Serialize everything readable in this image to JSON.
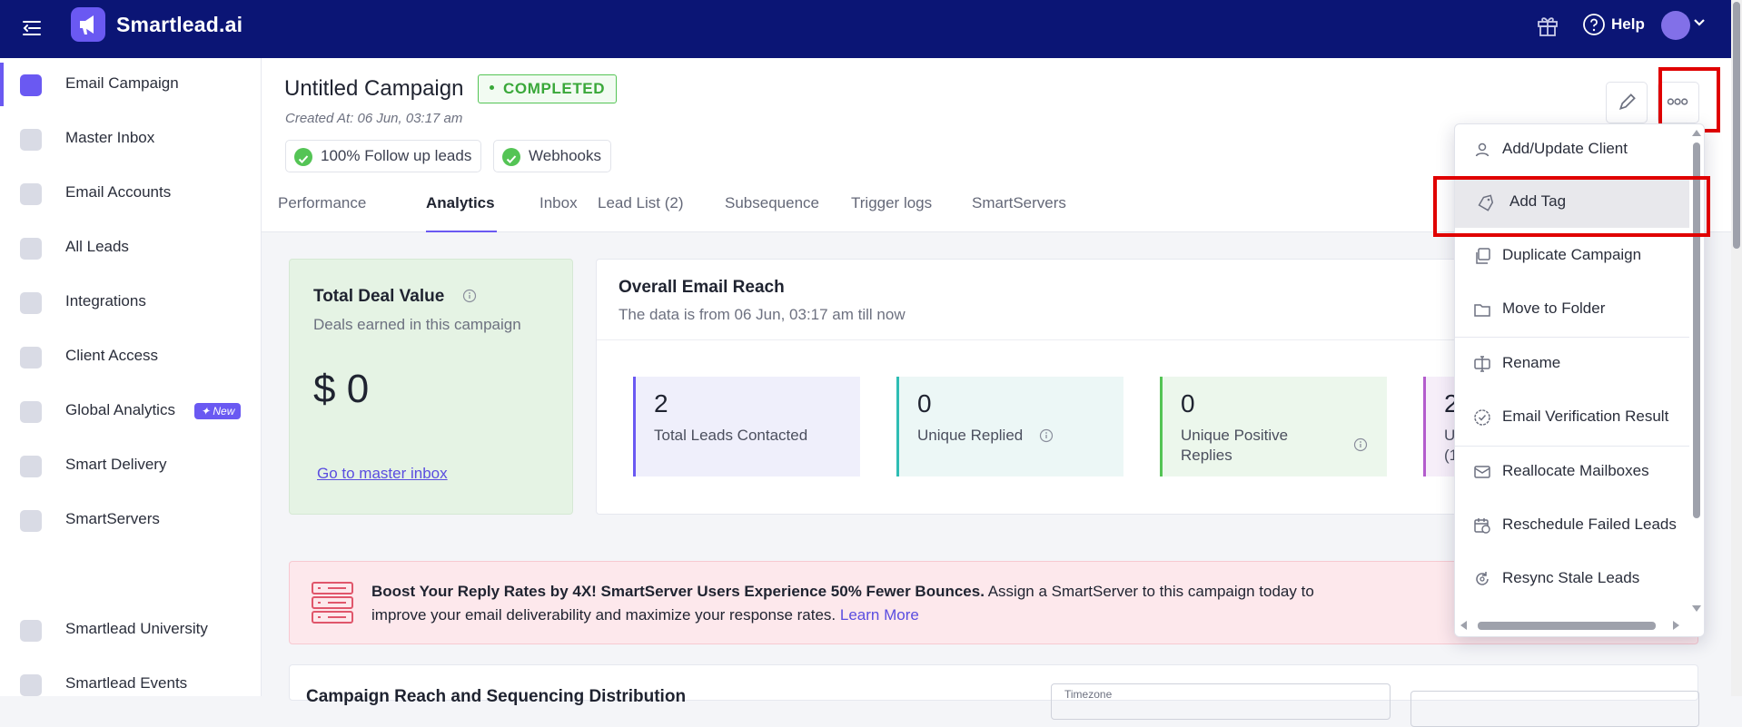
{
  "app": {
    "name": "Smartlead.ai",
    "help_label": "Help"
  },
  "icons": {
    "hamburger": "menu-collapse-icon",
    "logo": "megaphone-logo-icon",
    "gift": "gift-icon",
    "help": "question-circle-icon",
    "avatar": "user-avatar",
    "chevron": "chevron-down-icon"
  },
  "colors": {
    "topbar": "#0b1575",
    "accent": "#6a59f2",
    "success": "#54c455",
    "highlight": "#e00000"
  },
  "sidebar": {
    "items": [
      {
        "label": "Email Campaign",
        "icon": "megaphone-icon",
        "active": true
      },
      {
        "label": "Master Inbox",
        "icon": "inbox-icon"
      },
      {
        "label": "Email Accounts",
        "icon": "mail-icon"
      },
      {
        "label": "All Leads",
        "icon": "leads-icon"
      },
      {
        "label": "Integrations",
        "icon": "puzzle-icon"
      },
      {
        "label": "Client Access",
        "icon": "lightning-icon"
      },
      {
        "label": "Global Analytics",
        "icon": "bar-chart-icon",
        "badge": "✦ New"
      },
      {
        "label": "Smart Delivery",
        "icon": "layers-icon"
      },
      {
        "label": "SmartServers",
        "icon": "server-icon"
      }
    ],
    "bottom_items": [
      {
        "label": "Smartlead University",
        "icon": "university-icon"
      },
      {
        "label": "Smartlead Events",
        "icon": "events-icon"
      }
    ]
  },
  "campaign": {
    "title": "Untitled Campaign",
    "status": "COMPLETED",
    "created_at": "Created At: 06 Jun, 03:17 am",
    "pills": [
      "100% Follow up leads",
      "Webhooks"
    ]
  },
  "tabs": [
    "Performance",
    "Analytics",
    "Inbox",
    "Lead List (2)",
    "Subsequence",
    "Trigger logs",
    "SmartServers"
  ],
  "active_tab": "Analytics",
  "deal": {
    "title": "Total Deal Value",
    "subtitle": "Deals earned in this campaign",
    "value": "$ 0",
    "link": "Go to master inbox"
  },
  "reach": {
    "title": "Overall Email Reach",
    "subtitle": "The data is from 06 Jun, 03:17 am till now",
    "stats": [
      {
        "value": "2",
        "label": "Total Leads Contacted",
        "color": "#6a59f2",
        "bg": "#efeffb"
      },
      {
        "value": "0",
        "label": "Unique Replied",
        "color": "#2ebdb4",
        "bg": "#ecf7f6",
        "info": true
      },
      {
        "value": "0",
        "label": "Unique Positive Replies",
        "color": "#54c455",
        "bg": "#ecf7ec",
        "info": true
      },
      {
        "value": "2",
        "label": "U",
        "label2": "(1",
        "color": "#b35ccc",
        "bg": "#f6eef9"
      }
    ]
  },
  "promo": {
    "bold": "Boost Your Reply Rates by 4X! SmartServer Users Experience 50% Fewer Bounces.",
    "text": " Assign a SmartServer to this campaign today to improve your email deliverability and maximize your response rates.",
    "link": "Learn More"
  },
  "distribution": {
    "title": "Campaign Reach and Sequencing Distribution",
    "timezone_label": "Timezone"
  },
  "menu": {
    "items": [
      {
        "label": "Add/Update Client",
        "icon": "person-icon"
      },
      {
        "label": "Add Tag",
        "icon": "tag-icon",
        "hovered": true
      },
      {
        "label": "Duplicate Campaign",
        "icon": "copy-icon"
      },
      {
        "label": "Move to Folder",
        "icon": "folder-icon"
      },
      {
        "label": "Rename",
        "icon": "rename-icon"
      },
      {
        "label": "Email Verification Result",
        "icon": "verified-badge-icon"
      },
      {
        "label": "Reallocate Mailboxes",
        "icon": "mailbox-icon"
      },
      {
        "label": "Reschedule Failed Leads",
        "icon": "calendar-clock-icon"
      },
      {
        "label": "Resync Stale Leads",
        "icon": "resync-icon"
      }
    ]
  }
}
